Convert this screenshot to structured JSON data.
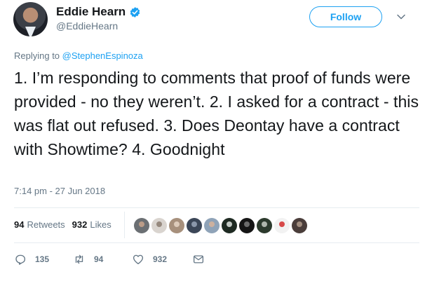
{
  "user": {
    "name": "Eddie Hearn",
    "handle": "@EddieHearn",
    "verified": true
  },
  "follow_label": "Follow",
  "reply": {
    "prefix": "Replying to ",
    "to": "@StephenEspinoza"
  },
  "tweet": {
    "text": "1. I’m responding to comments that proof of funds were provided - no they weren’t. 2. I asked for a contract - this was flat out refused. 3. Does Deontay have a contract with Showtime? 4. Goodnight",
    "timestamp": "7:14 pm - 27 Jun 2018"
  },
  "stats": {
    "retweets_count": "94",
    "retweets_label": "Retweets",
    "likes_count": "932",
    "likes_label": "Likes"
  },
  "likers": [
    {
      "bg": "#6b6f73",
      "fg": "#c9a58c"
    },
    {
      "bg": "#d9d4cf",
      "fg": "#8a7b70"
    },
    {
      "bg": "#a7907c",
      "fg": "#e6d6c6"
    },
    {
      "bg": "#3b4657",
      "fg": "#9aa6b8"
    },
    {
      "bg": "#8fa3b8",
      "fg": "#d8b49a"
    },
    {
      "bg": "#1e2a22",
      "fg": "#e1e6e2"
    },
    {
      "bg": "#151515",
      "fg": "#7a7a7a"
    },
    {
      "bg": "#2c3a2d",
      "fg": "#c7ccc4"
    },
    {
      "bg": "#f2f2f2",
      "fg": "#d22b2b"
    },
    {
      "bg": "#4a3d3a",
      "fg": "#b09b8c"
    }
  ],
  "actions": {
    "replies": "135",
    "retweets": "94",
    "likes": "932"
  },
  "colors": {
    "accent": "#1da1f2",
    "muted": "#657786",
    "text": "#14171a",
    "border": "#e6ecf0"
  }
}
